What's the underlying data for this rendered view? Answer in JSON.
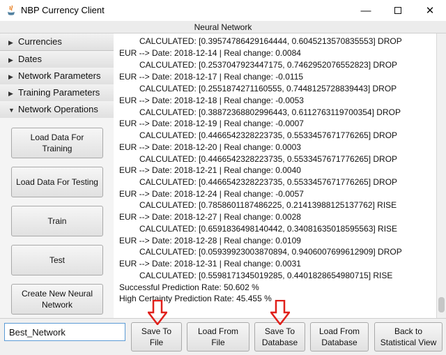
{
  "window": {
    "title": "NBP Currency Client",
    "minimize": "—",
    "close": "✕"
  },
  "panel": {
    "title": "Neural Network"
  },
  "sidebar": {
    "sections": [
      {
        "label": "Currencies",
        "arrow": "▶"
      },
      {
        "label": "Dates",
        "arrow": "▶"
      },
      {
        "label": "Network Parameters",
        "arrow": "▶"
      },
      {
        "label": "Training Parameters",
        "arrow": "▶"
      },
      {
        "label": "Network Operations",
        "arrow": "▼"
      }
    ],
    "buttons": {
      "load_training": "Load Data For Training",
      "load_testing": "Load Data For Testing",
      "train": "Train",
      "test": "Test",
      "create_network": "Create New Neural Network"
    }
  },
  "log": {
    "lines": [
      "CALCULATED: [0.39574786429164444, 0.6045213570835553] DROP",
      "EUR --> Date: 2018-12-14 | Real change: 0.0084",
      "CALCULATED: [0.2537047923447175, 0.7462952076552823] DROP",
      "EUR --> Date: 2018-12-17 | Real change: -0.0115",
      "CALCULATED: [0.2551874271160555, 0.7448125728839443] DROP",
      "EUR --> Date: 2018-12-18 | Real change: -0.0053",
      "CALCULATED: [0.38872368802996443, 0.6112763119700354] DROP",
      "EUR --> Date: 2018-12-19 | Real change: -0.0007",
      "CALCULATED: [0.4466542328223735, 0.5533457671776265] DROP",
      "EUR --> Date: 2018-12-20 | Real change: 0.0003",
      "CALCULATED: [0.4466542328223735, 0.5533457671776265] DROP",
      "EUR --> Date: 2018-12-21 | Real change: 0.0040",
      "CALCULATED: [0.4466542328223735, 0.5533457671776265] DROP",
      "EUR --> Date: 2018-12-24 | Real change: -0.0057",
      "CALCULATED: [0.7858601187486225, 0.21413988125137762] RISE",
      "EUR --> Date: 2018-12-27 | Real change: 0.0028",
      "CALCULATED: [0.6591836498140442, 0.34081635018595563] RISE",
      "EUR --> Date: 2018-12-28 | Real change: 0.0109",
      "CALCULATED: [0.05939923003870894, 0.9406007699612909] DROP",
      "EUR --> Date: 2018-12-31 | Real change: 0.0031",
      "CALCULATED: [0.5598171345019285, 0.4401828654980715] RISE",
      "Successful Prediction Rate: 50.602 %",
      "High Certainty Prediction Rate: 45.455 %"
    ]
  },
  "bottom": {
    "network_name_value": "Best_Network",
    "save_file": "Save To File",
    "load_file": "Load From File",
    "save_db": "Save To Database",
    "load_db": "Load From Database",
    "back_stats": "Back to Statistical View"
  },
  "colors": {
    "annotation_arrow": "#e0201b",
    "input_focus": "#5b9bd5"
  }
}
